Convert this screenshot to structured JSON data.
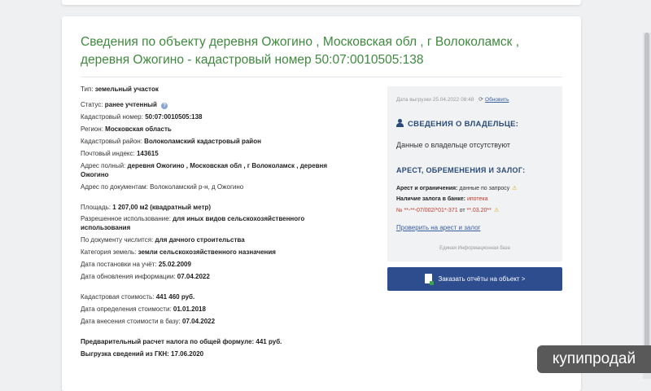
{
  "title": "Сведения по объекту деревня Ожогино , Московская обл , г Волоколамск , деревня Ожогино - кадастровый номер 50:07:0010505:138",
  "info_rows": {
    "type_label": "Тип:",
    "type_value": "земельный участок",
    "status_label": "Статус:",
    "status_value": "ранее учтенный",
    "cad_label": "Кадастровый номер:",
    "cad_value": "50:07:0010505:138",
    "region_label": "Регион:",
    "region_value": "Московская область",
    "district_label": "Кадастровый район:",
    "district_value": "Волоколамский кадастровый район",
    "zip_label": "Почтовый индекс:",
    "zip_value": "143615",
    "addr_label": "Адрес полный:",
    "addr_value": "деревня Ожогино , Московская обл , г Волоколамск , деревня Ожогино",
    "addr_doc_label": "Адрес по документам:",
    "addr_doc_value": "Волоколамский р-н, д Ожогино",
    "area_label": "Площадь:",
    "area_value": "1 207,00 м2 (квадратный метр)",
    "use_label": "Разрешенное использование:",
    "use_value": "для иных видов сельскохозяйственного использования",
    "doc_label": "По документу числится:",
    "doc_value": "для дачного строительства",
    "cat_label": "Категория земель:",
    "cat_value": "земли сельскохозяйственного назначения",
    "reg_date_label": "Дата постановки на учёт:",
    "reg_date_value": "25.02.2009",
    "upd_date_label": "Дата обновления информации:",
    "upd_date_value": "07.04.2022",
    "cost_label": "Кадастровая стоимость:",
    "cost_value": "441 460 руб.",
    "cost_date_label": "Дата определения стоимости:",
    "cost_date_value": "01.01.2018",
    "cost_db_label": "Дата внесения стоимости в базу:",
    "cost_db_value": "07.04.2022",
    "tax_text": "Предварительный расчет налога по общей формуле: 441 руб.",
    "gkn_text": "Выгрузка сведений из ГКН: 17.06.2020"
  },
  "side": {
    "export_date": "Дата выгрузки 25.04.2022 08:48",
    "refresh_label": "Обновить",
    "owner_heading": "СВЕДЕНИЯ О ВЛАДЕЛЬЦЕ:",
    "owner_text": "Данные о владельце отсутствуют",
    "arrest_heading": "АРЕСТ, ОБРЕМЕНЕНИЯ И ЗАЛОГ:",
    "arrest_label": "Арест и ограничения:",
    "arrest_value": "данные по запросу",
    "pledge_label": "Наличие залога в банке:",
    "pledge_value": "ипотека",
    "pledge_number": "№ **-**-07/002/*01*-371",
    "pledge_from": "от",
    "pledge_date": "**.03.20**",
    "check_link": "Проверить на арест и залог",
    "eis_label": "Единая Информационная база"
  },
  "order_button": "Заказать отчёты на объект >",
  "watermark": "купипродай",
  "colors": {
    "title": "#3f8a3e",
    "heading": "#2a4b78",
    "button": "#2e4d8f",
    "link": "#3a5fa0"
  }
}
